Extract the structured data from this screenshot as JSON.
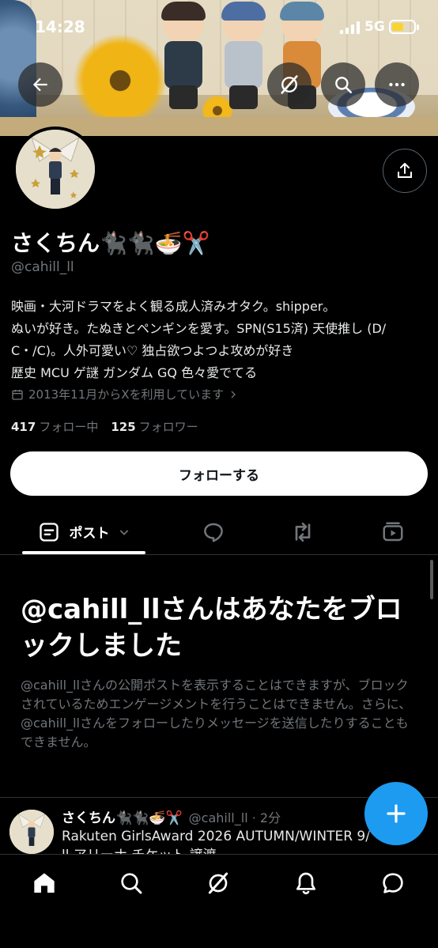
{
  "status_bar": {
    "time": "14:28",
    "network": "5G"
  },
  "banner": {
    "icons": [
      "back-arrow-icon",
      "grok-icon",
      "search-icon",
      "more-icon"
    ]
  },
  "profile": {
    "display_name": "さくちん🐈‍⬛🐈‍⬛🍜✂️",
    "handle": "@cahill_ll",
    "bio_lines": [
      "映画・大河ドラマをよく観る成人済みオタク。shipper。",
      "ぬいが好き。たぬきとペンギンを愛す。SPN(S15済) 天使推し (D/",
      "C・/C)。人外可愛い♡ 独占欲つよつよ攻めが好き",
      "歴史 MCU ゲ謎 ガンダム GQ 色々愛でてる"
    ],
    "joined": "2013年11月からXを利用しています",
    "following_count": "417",
    "following_label": "フォロー中",
    "followers_count": "125",
    "followers_label": "フォロワー",
    "follow_button": "フォローする"
  },
  "tabs": {
    "active_label": "ポスト",
    "items": [
      "posts-icon",
      "replies-icon",
      "reposts-icon",
      "media-icon"
    ]
  },
  "blocked": {
    "title": "@cahill_llさんはあなたをブロックしました",
    "description": "@cahill_llさんの公開ポストを表示することはできますが、ブロックされているためエンゲージメントを行うことはできません。さらに、@cahill_llさんをフォローしたりメッセージを送信したりすることもできません。"
  },
  "post": {
    "name": "さくちん🐈‍⬛🐈‍⬛🍜✂️",
    "meta": "@cahill_ll · 2分",
    "text": "Rakuten GirlsAward 2026 AUTUMN/WINTER 9/",
    "text_line2": "ll アリーナ チケット 譲渡"
  },
  "bottom_nav": [
    "home-icon",
    "search-icon",
    "grok-icon",
    "notifications-icon",
    "messages-icon"
  ],
  "colors": {
    "accent": "#1d9bf0",
    "background": "#000000",
    "muted": "#71767b",
    "battery": "#f7d432"
  }
}
